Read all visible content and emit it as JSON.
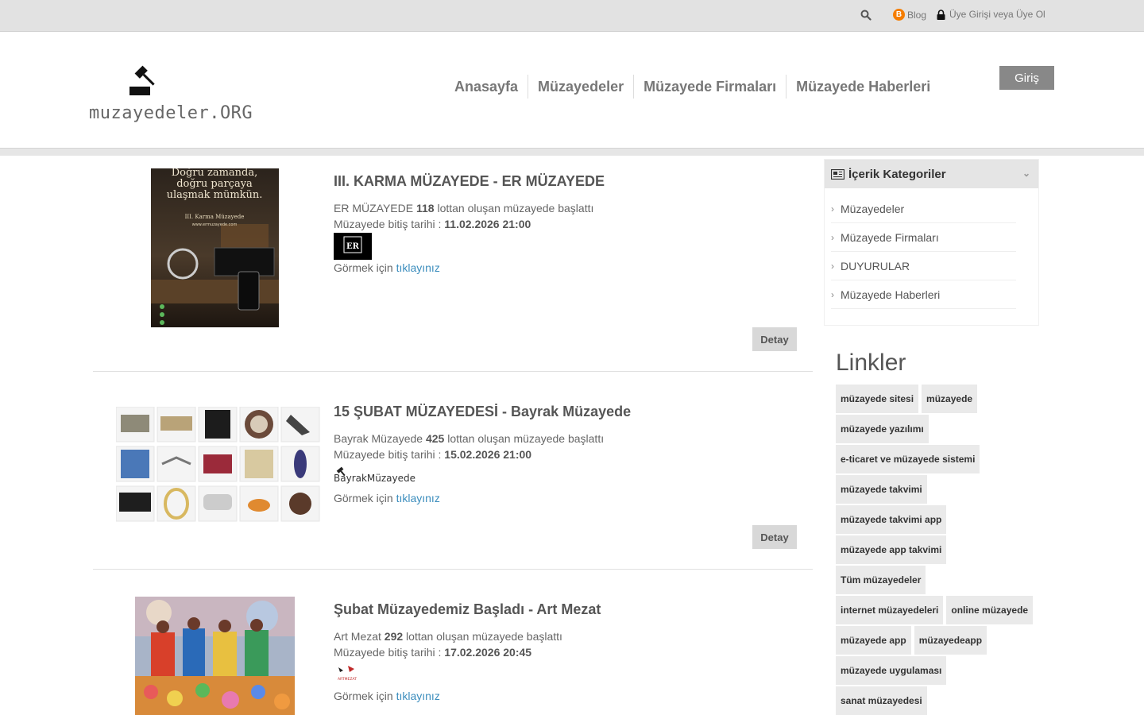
{
  "topbar": {
    "blog_label": "Blog",
    "login_label": "Üye Girişi veya Üye Ol"
  },
  "header": {
    "logo_text": "muzayedeler.ORG",
    "nav": [
      "Anasayfa",
      "Müzayedeler",
      "Müzayede Firmaları",
      "Müzayede Haberleri"
    ],
    "login_button": "Giriş"
  },
  "listings": [
    {
      "title": "III. KARMA MÜZAYEDE - ER MÜZAYEDE",
      "firm": "ER MÜZAYEDE",
      "lot_count": "118",
      "lot_text": "lottan oluşan müzayede başlattı",
      "end_label": "Müzayede bitiş tarihi :",
      "end_date": "11.02.2026 21:00",
      "see_label": "Görmek için",
      "see_link": "tıklayınız",
      "detail_button": "Detay",
      "poster_lines": [
        "Doğru zamanda,",
        "doğru parçaya",
        "ulaşmak mümkün.",
        "III. Karma Müzayede",
        "www.ermuzayede.com"
      ],
      "firm_logo_text": "ER"
    },
    {
      "title": "15 ŞUBAT MÜZAYEDESİ - Bayrak Müzayede",
      "firm": "Bayrak Müzayede",
      "lot_count": "425",
      "lot_text": "lottan oluşan müzayede başlattı",
      "end_label": "Müzayede bitiş tarihi :",
      "end_date": "15.02.2026 21:00",
      "see_label": "Görmek için",
      "see_link": "tıklayınız",
      "detail_button": "Detay",
      "firm_logo_text": "BayrakMüzayede"
    },
    {
      "title": "Şubat Müzayedemiz Başladı - Art Mezat",
      "firm": "Art Mezat",
      "lot_count": "292",
      "lot_text": "lottan oluşan müzayede başlattı",
      "end_label": "Müzayede bitiş tarihi :",
      "end_date": "17.02.2026 20:45",
      "see_label": "Görmek için",
      "see_link": "tıklayınız",
      "firm_logo_text": "ARTMEZAT"
    }
  ],
  "sidebar": {
    "categories_title": "İçerik Kategoriler",
    "categories": [
      "Müzayedeler",
      "Müzayede Firmaları",
      "DUYURULAR",
      "Müzayede Haberleri"
    ],
    "links_title": "Linkler",
    "tags": [
      "müzayede sitesi",
      "müzayede",
      "müzayede yazılımı",
      "e-ticaret ve müzayede sistemi",
      "müzayede takvimi",
      "müzayede takvimi app",
      "müzayede app takvimi",
      "Tüm müzayedeler",
      "internet müzayedeleri",
      "online müzayede",
      "müzayede app",
      "müzayedeapp",
      "müzayede uygulaması",
      "sanat müzayedesi"
    ]
  }
}
